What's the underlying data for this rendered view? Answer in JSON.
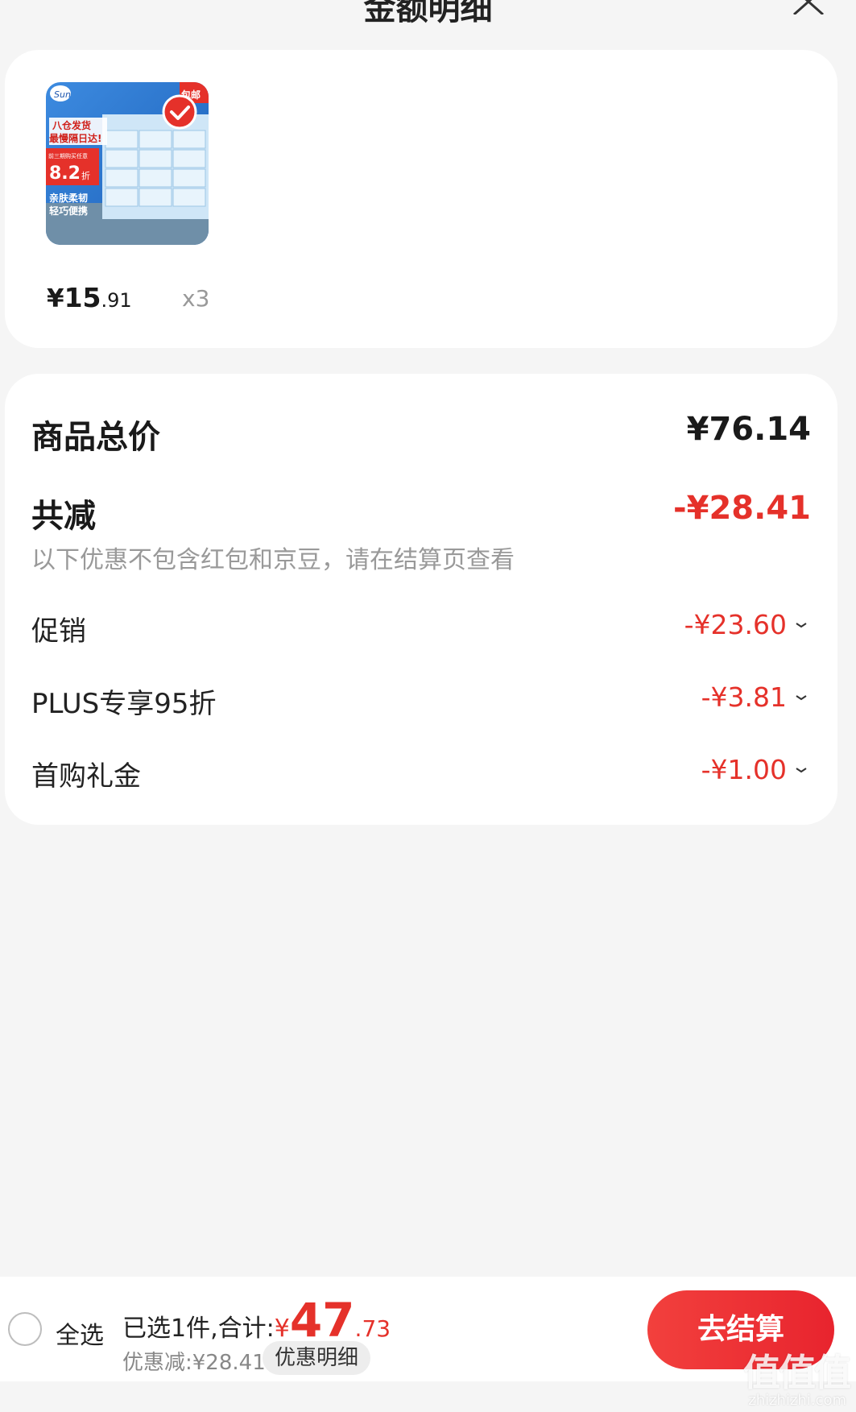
{
  "header": {
    "title": "金额明细"
  },
  "product": {
    "price_int": "15",
    "price_dec": ".91",
    "currency": "¥",
    "qty": "x3",
    "image_text": {
      "brand": "Sun",
      "line1": "八仓发货",
      "line2": "最慢隔日达!",
      "discount_note": "前三期购买任意",
      "discount": "8.2",
      "discount_unit": "折",
      "line3": "亲肤柔韧",
      "line4": "轻巧便携",
      "badge": "包邮"
    }
  },
  "detail": {
    "total_label": "商品总价",
    "total_value": "¥76.14",
    "reduce_label": "共减",
    "reduce_value": "-¥28.41",
    "note": "以下优惠不包含红包和京豆，请在结算页查看",
    "items": [
      {
        "label": "促销",
        "value": "-¥23.60"
      },
      {
        "label": "PLUS专享95折",
        "value": "-¥3.81"
      },
      {
        "label": "首购礼金",
        "value": "-¥1.00"
      }
    ]
  },
  "bottom": {
    "select_all": "全选",
    "selected_text": "已选1件,合计:",
    "currency": "¥",
    "total_int": "47",
    "total_dec": ".73",
    "saved": "优惠减:¥28.41",
    "promo_detail": "优惠明细",
    "checkout": "去结算"
  },
  "watermark": {
    "glyphs": "值值值",
    "site": "zhizhizhi.com"
  },
  "colors": {
    "accent": "#e5312a",
    "background": "#f5f5f5",
    "card": "#ffffff"
  }
}
